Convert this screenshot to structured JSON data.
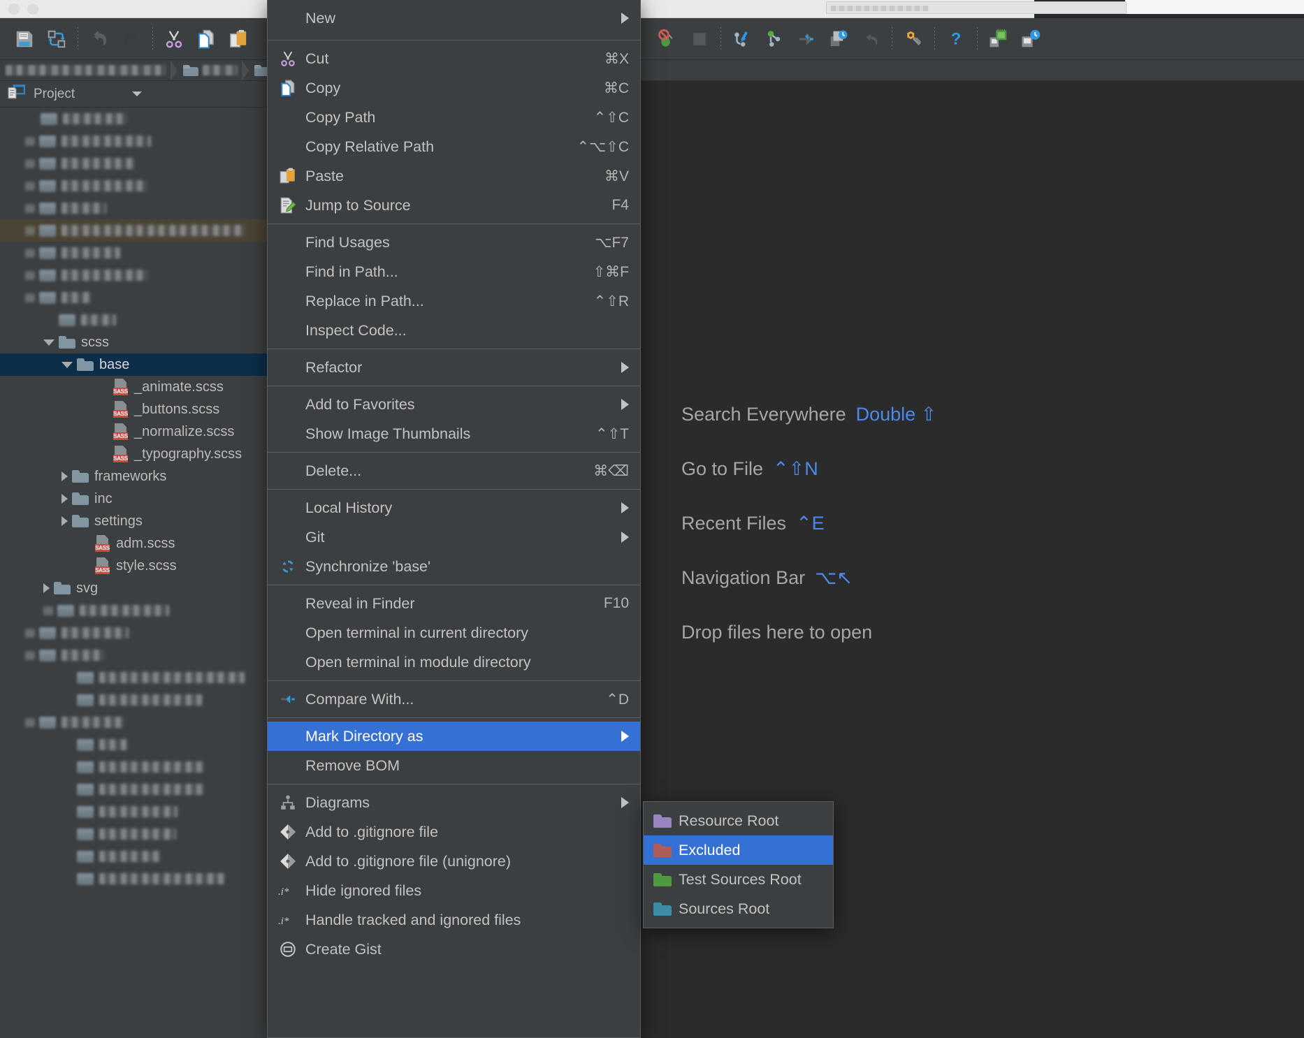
{
  "window": {
    "traffic_lights": [
      "close",
      "minimize",
      "zoom"
    ]
  },
  "toolbar": {
    "left_buttons": [
      {
        "name": "save-all-icon",
        "label": "Save All"
      },
      {
        "name": "sync-icon",
        "label": "Synchronize"
      },
      {
        "name": "undo-icon",
        "label": "Undo"
      },
      {
        "name": "redo-icon",
        "label": "Redo"
      },
      {
        "name": "cut-icon",
        "label": "Cut"
      },
      {
        "name": "copy-icon",
        "label": "Copy"
      },
      {
        "name": "paste-icon",
        "label": "Paste"
      }
    ],
    "right_buttons": [
      {
        "name": "stop-debug-icon",
        "label": "Stop Debugger"
      },
      {
        "name": "stop-icon",
        "label": "Stop"
      },
      {
        "name": "update-project-icon",
        "label": "Update Project"
      },
      {
        "name": "commit-icon",
        "label": "Commit"
      },
      {
        "name": "compare-icon",
        "label": "Compare"
      },
      {
        "name": "history-icon",
        "label": "Show History"
      },
      {
        "name": "rollback-icon",
        "label": "Rollback"
      },
      {
        "name": "settings-icon",
        "label": "Settings"
      },
      {
        "name": "help-icon",
        "label": "Help"
      },
      {
        "name": "deploy-icon",
        "label": "Deploy"
      },
      {
        "name": "sync-remote-icon",
        "label": "Sync with Remote"
      }
    ]
  },
  "project_panel": {
    "title": "Project",
    "tree": [
      {
        "indent": 1,
        "twisty": "none",
        "type": "blur",
        "blur_w": 92,
        "label": ""
      },
      {
        "indent": 1,
        "twisty": "blur",
        "type": "blur",
        "blur_w": 128,
        "label": ""
      },
      {
        "indent": 1,
        "twisty": "blur",
        "type": "blur",
        "blur_w": 105,
        "label": ""
      },
      {
        "indent": 1,
        "twisty": "blur",
        "type": "blur",
        "blur_w": 123,
        "label": ""
      },
      {
        "indent": 1,
        "twisty": "blur",
        "type": "blur",
        "blur_w": 64,
        "label": ""
      },
      {
        "indent": 1,
        "twisty": "blur",
        "type": "blur",
        "blur_w": 262,
        "label": "",
        "highlight": true
      },
      {
        "indent": 1,
        "twisty": "blur",
        "type": "blur",
        "blur_w": 84,
        "label": ""
      },
      {
        "indent": 1,
        "twisty": "blur",
        "type": "blur",
        "blur_w": 124,
        "label": ""
      },
      {
        "indent": 1,
        "twisty": "blur",
        "type": "blur",
        "blur_w": 42,
        "label": ""
      },
      {
        "indent": 2,
        "twisty": "none",
        "type": "blur",
        "blur_w": 50,
        "label": ""
      },
      {
        "indent": 2,
        "twisty": "open",
        "type": "folder",
        "folder_color": "#8195a3",
        "label": "scss"
      },
      {
        "indent": 3,
        "twisty": "open",
        "type": "folder",
        "folder_color": "#8195a3",
        "label": "base",
        "selected": true
      },
      {
        "indent": 5,
        "twisty": "none",
        "type": "sass",
        "label": "_animate.scss"
      },
      {
        "indent": 5,
        "twisty": "none",
        "type": "sass",
        "label": "_buttons.scss"
      },
      {
        "indent": 5,
        "twisty": "none",
        "type": "sass",
        "label": "_normalize.scss"
      },
      {
        "indent": 5,
        "twisty": "none",
        "type": "sass",
        "label": "_typography.scss"
      },
      {
        "indent": 3,
        "twisty": "closed",
        "type": "folder",
        "folder_color": "#8195a3",
        "label": "frameworks"
      },
      {
        "indent": 3,
        "twisty": "closed",
        "type": "folder",
        "folder_color": "#8195a3",
        "label": "inc"
      },
      {
        "indent": 3,
        "twisty": "closed",
        "type": "folder",
        "folder_color": "#8195a3",
        "label": "settings"
      },
      {
        "indent": 4,
        "twisty": "none",
        "type": "sass",
        "label": "adm.scss"
      },
      {
        "indent": 4,
        "twisty": "none",
        "type": "sass",
        "label": "style.scss"
      },
      {
        "indent": 2,
        "twisty": "closed",
        "type": "folder",
        "folder_color": "#8195a3",
        "label": "svg"
      },
      {
        "indent": 2,
        "twisty": "blur",
        "type": "blur",
        "blur_w": 128,
        "label": ""
      },
      {
        "indent": 1,
        "twisty": "blur",
        "type": "blur",
        "blur_w": 96,
        "label": ""
      },
      {
        "indent": 1,
        "twisty": "blur",
        "type": "blur",
        "blur_w": 62,
        "label": ""
      },
      {
        "indent": 3,
        "twisty": "none",
        "type": "blur",
        "blur_w": 208,
        "label": ""
      },
      {
        "indent": 3,
        "twisty": "none",
        "type": "blur",
        "blur_w": 148,
        "label": ""
      },
      {
        "indent": 1,
        "twisty": "blur",
        "type": "blur",
        "blur_w": 90,
        "label": ""
      },
      {
        "indent": 3,
        "twisty": "none",
        "type": "blur",
        "blur_w": 40,
        "label": ""
      },
      {
        "indent": 3,
        "twisty": "none",
        "type": "blur",
        "blur_w": 150,
        "label": ""
      },
      {
        "indent": 3,
        "twisty": "none",
        "type": "blur",
        "blur_w": 150,
        "label": ""
      },
      {
        "indent": 3,
        "twisty": "none",
        "type": "blur",
        "blur_w": 112,
        "label": ""
      },
      {
        "indent": 3,
        "twisty": "none",
        "type": "blur",
        "blur_w": 110,
        "label": ""
      },
      {
        "indent": 3,
        "twisty": "none",
        "type": "blur",
        "blur_w": 88,
        "label": ""
      },
      {
        "indent": 3,
        "twisty": "none",
        "type": "blur",
        "blur_w": 180,
        "label": ""
      }
    ]
  },
  "editor_welcome": {
    "items": [
      {
        "label": "Search Everywhere",
        "shortcut": "Double ⇧"
      },
      {
        "label": "Go to File",
        "shortcut": "⌃⇧N"
      },
      {
        "label": "Recent Files",
        "shortcut": "⌃E"
      },
      {
        "label": "Navigation Bar",
        "shortcut": "⌥↖"
      },
      {
        "label": "Drop files here to open",
        "shortcut": ""
      }
    ]
  },
  "context_menu": {
    "items": [
      {
        "label": "New",
        "accel": "",
        "icon": "",
        "submenu": true,
        "kind": "first"
      },
      {
        "kind": "separator"
      },
      {
        "label": "Cut",
        "accel": "⌘X",
        "icon": "scissors-icon"
      },
      {
        "label": "Copy",
        "accel": "⌘C",
        "icon": "copy-icon"
      },
      {
        "label": "Copy Path",
        "accel": "⌃⇧C",
        "icon": ""
      },
      {
        "label": "Copy Relative Path",
        "accel": "⌃⌥⇧C",
        "icon": ""
      },
      {
        "label": "Paste",
        "accel": "⌘V",
        "icon": "paste-icon"
      },
      {
        "label": "Jump to Source",
        "accel": "F4",
        "icon": "jump-to-source-icon"
      },
      {
        "kind": "separator"
      },
      {
        "label": "Find Usages",
        "accel": "⌥F7",
        "icon": ""
      },
      {
        "label": "Find in Path...",
        "accel": "⇧⌘F",
        "icon": ""
      },
      {
        "label": "Replace in Path...",
        "accel": "⌃⇧R",
        "icon": ""
      },
      {
        "label": "Inspect Code...",
        "accel": "",
        "icon": ""
      },
      {
        "kind": "separator"
      },
      {
        "label": "Refactor",
        "accel": "",
        "icon": "",
        "submenu": true
      },
      {
        "kind": "separator"
      },
      {
        "label": "Add to Favorites",
        "accel": "",
        "icon": "",
        "submenu": true
      },
      {
        "label": "Show Image Thumbnails",
        "accel": "⌃⇧T",
        "icon": ""
      },
      {
        "kind": "separator"
      },
      {
        "label": "Delete...",
        "accel": "⌘⌫",
        "icon": ""
      },
      {
        "kind": "separator"
      },
      {
        "label": "Local History",
        "accel": "",
        "icon": "",
        "submenu": true
      },
      {
        "label": "Git",
        "accel": "",
        "icon": "",
        "submenu": true
      },
      {
        "label": "Synchronize 'base'",
        "accel": "",
        "icon": "sync-icon"
      },
      {
        "kind": "separator"
      },
      {
        "label": "Reveal in Finder",
        "accel": "F10",
        "icon": ""
      },
      {
        "label": "Open terminal in current directory",
        "accel": "",
        "icon": ""
      },
      {
        "label": "Open terminal in module directory",
        "accel": "",
        "icon": ""
      },
      {
        "kind": "separator"
      },
      {
        "label": "Compare With...",
        "accel": "⌃D",
        "icon": "compare-icon"
      },
      {
        "kind": "separator"
      },
      {
        "label": "Mark Directory as",
        "accel": "",
        "icon": "",
        "submenu": true,
        "selected": true
      },
      {
        "label": "Remove BOM",
        "accel": "",
        "icon": ""
      },
      {
        "kind": "separator"
      },
      {
        "label": "Diagrams",
        "accel": "",
        "icon": "diagram-icon",
        "submenu": true
      },
      {
        "label": "Add to .gitignore file",
        "accel": "",
        "icon": "git-icon"
      },
      {
        "label": "Add to .gitignore file (unignore)",
        "accel": "",
        "icon": "git-icon"
      },
      {
        "label": "Hide ignored files",
        "accel": "",
        "icon": "ignored-files-icon"
      },
      {
        "label": "Handle tracked and ignored files",
        "accel": "",
        "icon": "ignored-files-icon"
      },
      {
        "label": "Create Gist",
        "accel": "",
        "icon": "gist-icon",
        "cut": true
      }
    ]
  },
  "submenu": {
    "title": "Mark Directory as",
    "items": [
      {
        "label": "Resource Root",
        "color": "#9a84c0"
      },
      {
        "label": "Excluded",
        "color": "#b05c59",
        "selected": true
      },
      {
        "label": "Test Sources Root",
        "color": "#4e9a3f"
      },
      {
        "label": "Sources Root",
        "color": "#3d8ca6"
      }
    ]
  },
  "colors": {
    "menu_bg": "#3c3f41",
    "menu_highlight": "#3570d4",
    "editor_bg": "#2b2b2b",
    "panel_bg": "#3c3f41",
    "tree_selected": "#0d2e49",
    "accent_blue": "#4d89f0",
    "sass_badge": "#c94a42"
  }
}
